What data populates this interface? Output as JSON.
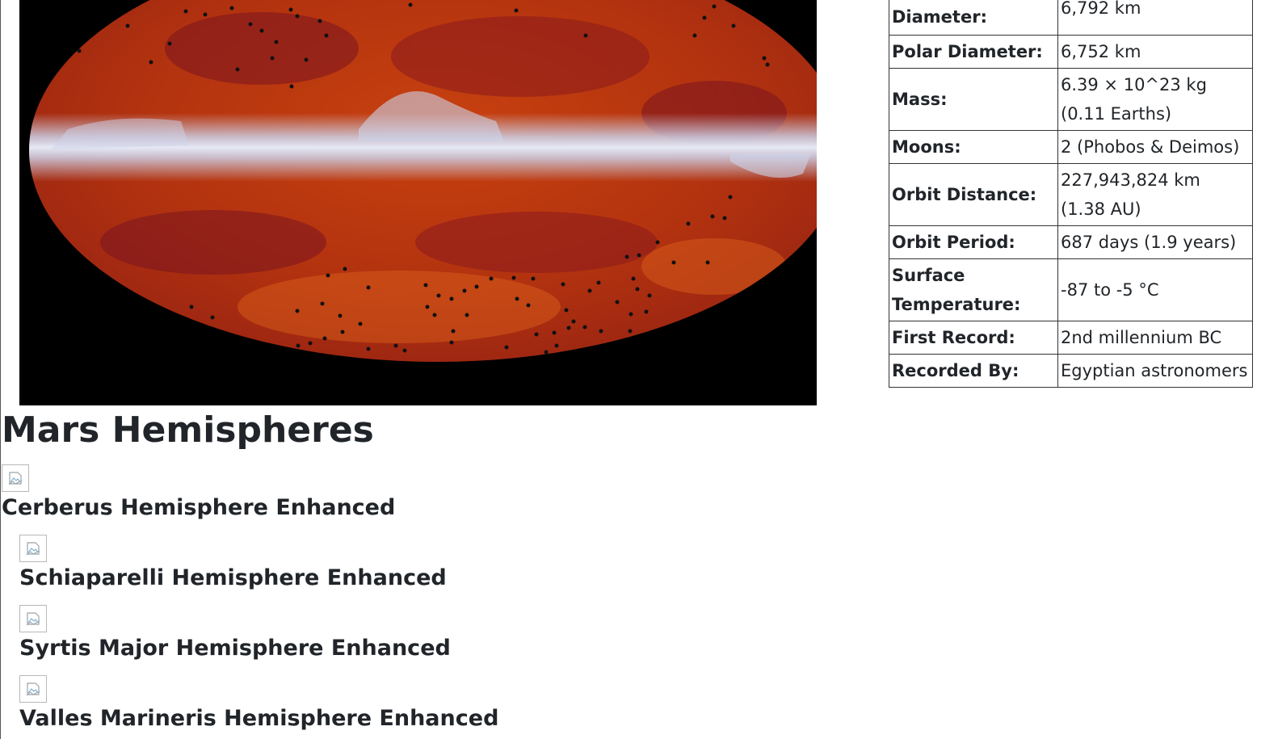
{
  "facts": [
    {
      "label": "Diameter:",
      "value": "6,792 km"
    },
    {
      "label": "Polar Diameter:",
      "value": "6,752 km"
    },
    {
      "label": "Mass:",
      "value": "6.39 × 10^23 kg (0.11 Earths)"
    },
    {
      "label": "Moons:",
      "value": "2 (Phobos & Deimos)"
    },
    {
      "label": "Orbit Distance:",
      "value": "227,943,824 km (1.38 AU)"
    },
    {
      "label": "Orbit Period:",
      "value": "687 days (1.9 years)"
    },
    {
      "label": "Surface Temperature:",
      "value": "-87 to -5 °C"
    },
    {
      "label": "First Record:",
      "value": "2nd millennium BC"
    },
    {
      "label": "Recorded By:",
      "value": "Egyptian astronomers"
    }
  ],
  "hemispheres": {
    "heading": "Mars Hemispheres",
    "items": [
      {
        "title": "Cerberus Hemisphere Enhanced",
        "image_icon": "broken-image-icon"
      },
      {
        "title": "Schiaparelli Hemisphere Enhanced",
        "image_icon": "broken-image-icon"
      },
      {
        "title": "Syrtis Major Hemisphere Enhanced",
        "image_icon": "broken-image-icon"
      },
      {
        "title": "Valles Marineris Hemisphere Enhanced",
        "image_icon": "broken-image-icon"
      }
    ]
  },
  "colors": {
    "sky_map_base": "#c13c0c",
    "sky_map_dark": "#7a1420",
    "galactic_band": "#cdd3ea",
    "text": "#212529"
  }
}
